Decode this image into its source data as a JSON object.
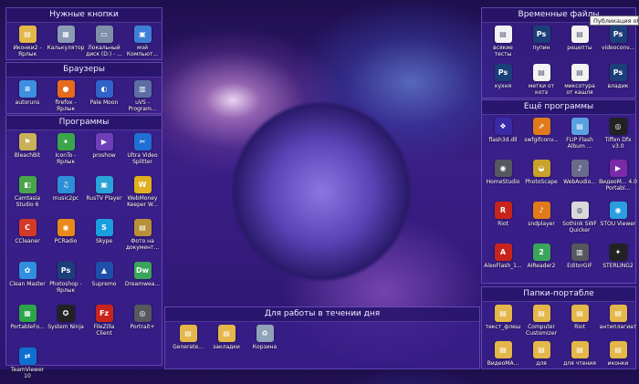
{
  "fences": {
    "nuzhnye": {
      "title": "Нужные кнопки",
      "items": [
        {
          "label": "Иконки2 - Ярлык",
          "icon": "folder-icon",
          "color": "#e3b74a",
          "glyph": "▤"
        },
        {
          "label": "Калькулятор",
          "icon": "calculator-icon",
          "color": "#8a9bb5",
          "glyph": "▦"
        },
        {
          "label": "Локальный диск (D:) - ...",
          "icon": "hard-drive-icon",
          "color": "#7e8fa8",
          "glyph": "▭"
        },
        {
          "label": "мой Компьют...",
          "icon": "computer-icon",
          "color": "#3d7fd6",
          "glyph": "▣"
        }
      ]
    },
    "brauzery": {
      "title": "Браузеры",
      "items": [
        {
          "label": "autoruns",
          "icon": "autoruns-icon",
          "color": "#3d8fe0",
          "glyph": "≡"
        },
        {
          "label": "firefox - Ярлык",
          "icon": "firefox-icon",
          "color": "#e86a1c",
          "glyph": "●"
        },
        {
          "label": "Pale Moon",
          "icon": "pale-moon-icon",
          "color": "#2f63c9",
          "glyph": "◐"
        },
        {
          "label": "uVS - Program...",
          "icon": "uvs-program-icon",
          "color": "#5c6ea3",
          "glyph": "▥"
        }
      ]
    },
    "programmy": {
      "title": "Программы",
      "items": [
        {
          "label": "BleachBit",
          "icon": "bleachbit-icon",
          "color": "#c9b15a",
          "glyph": "⚑"
        },
        {
          "label": "IconTo - Ярлык",
          "icon": "iconto-icon",
          "color": "#3aa54a",
          "glyph": "✦"
        },
        {
          "label": "proshow",
          "icon": "proshow-icon",
          "color": "#6e3fb8",
          "glyph": "▶"
        },
        {
          "label": "Ultra Video Splitter",
          "icon": "video-splitter-icon",
          "color": "#1f6fd6",
          "glyph": "✂"
        },
        {
          "label": "Camtasia Studio 6",
          "icon": "camtasia-icon",
          "color": "#4aa54a",
          "glyph": "◧"
        },
        {
          "label": "music2pc",
          "icon": "music2pc-icon",
          "color": "#2c8fd8",
          "glyph": "♫"
        },
        {
          "label": "RusTV Player",
          "icon": "rustv-icon",
          "color": "#29a3d9",
          "glyph": "▣"
        },
        {
          "label": "WebMoney Keeper W...",
          "icon": "webmoney-icon",
          "color": "#e0b020",
          "glyph": "W"
        },
        {
          "label": "CCleaner",
          "icon": "ccleaner-icon",
          "color": "#d33a2a",
          "glyph": "C"
        },
        {
          "label": "PCRadio",
          "icon": "pcradio-icon",
          "color": "#e88a1a",
          "glyph": "◉"
        },
        {
          "label": "Skype",
          "icon": "skype-icon",
          "color": "#1a9ee0",
          "glyph": "S"
        },
        {
          "label": "Фото на документ...",
          "icon": "photo-document-icon",
          "color": "#b8903a",
          "glyph": "▤"
        },
        {
          "label": "Clean Master",
          "icon": "clean-master-icon",
          "color": "#2f8fe0",
          "glyph": "✿"
        },
        {
          "label": "Photoshop - Ярлык",
          "icon": "photoshop-icon",
          "color": "#1c3f7a",
          "glyph": "Ps"
        },
        {
          "label": "Supremo",
          "icon": "supremo-icon",
          "color": "#1e4fa8",
          "glyph": "▲"
        },
        {
          "label": "Dreamwea...",
          "icon": "dreamweaver-icon",
          "color": "#3aa55a",
          "glyph": "Dw"
        },
        {
          "label": "PortableFo...",
          "icon": "portable-folder-icon",
          "color": "#2ba54a",
          "glyph": "▦"
        },
        {
          "label": "System Ninja",
          "icon": "system-ninja-icon",
          "color": "#222222",
          "glyph": "✪"
        },
        {
          "label": "FileZilla Client",
          "icon": "filezilla-icon",
          "color": "#c8241c",
          "glyph": "Fz"
        },
        {
          "label": "Portrait+",
          "icon": "portrait-plus-icon",
          "color": "#55585e",
          "glyph": "◎"
        },
        {
          "label": "TeamViewer 10",
          "icon": "teamviewer-icon",
          "color": "#0e6fd0",
          "glyph": "⇄"
        }
      ]
    },
    "vremennye": {
      "title": "Временные файлы",
      "items": [
        {
          "label": "всякие тесты",
          "icon": "document-icon",
          "color": "#f2f2f2",
          "glyph": "▤"
        },
        {
          "label": "пупин",
          "icon": "psd-file-icon",
          "color": "#1c3f7a",
          "glyph": "Ps"
        },
        {
          "label": "рецепты",
          "icon": "document-icon",
          "color": "#f2f2f2",
          "glyph": "▤"
        },
        {
          "label": "videoconv...",
          "icon": "psd-file-icon",
          "color": "#1c3f7a",
          "glyph": "Ps"
        },
        {
          "label": "кухня",
          "icon": "psd-file-icon",
          "color": "#1c3f7a",
          "glyph": "Ps"
        },
        {
          "label": "метки от котэ",
          "icon": "document-icon",
          "color": "#f2f2f2",
          "glyph": "▤"
        },
        {
          "label": "миксотура от кашля",
          "icon": "document-icon",
          "color": "#f2f2f2",
          "glyph": "▤"
        },
        {
          "label": "владик",
          "icon": "psd-file-icon",
          "color": "#1c3f7a",
          "glyph": "Ps"
        }
      ]
    },
    "esche": {
      "title": "Ещё программы",
      "items": [
        {
          "label": "flash3d.dll",
          "icon": "flash3d-icon",
          "color": "#3a2aa8",
          "glyph": "❖"
        },
        {
          "label": "swfgifconv...",
          "icon": "swfgif-icon",
          "color": "#e07a1a",
          "glyph": "⇗"
        },
        {
          "label": "FLIP Flash Album ...",
          "icon": "flip-album-icon",
          "color": "#5aa0e0",
          "glyph": "▤"
        },
        {
          "label": "Tiffen Dfx v3.0",
          "icon": "tiffen-icon",
          "color": "#222222",
          "glyph": "◎"
        },
        {
          "label": "HomeStudio",
          "icon": "homestudio-icon",
          "color": "#55585e",
          "glyph": "◉"
        },
        {
          "label": "PhotoScape",
          "icon": "photoscape-icon",
          "color": "#c8a22a",
          "glyph": "◒"
        },
        {
          "label": "WebAudio...",
          "icon": "webaudio-icon",
          "color": "#6a6a8a",
          "glyph": "♪"
        },
        {
          "label": "ВидеоМ... 4.0 Portabl...",
          "icon": "videomaster-icon",
          "color": "#7a2aa8",
          "glyph": "▶"
        },
        {
          "label": "Riot",
          "icon": "riot-icon",
          "color": "#c8241c",
          "glyph": "R"
        },
        {
          "label": "sndplayer",
          "icon": "sndplayer-icon",
          "color": "#e07a1a",
          "glyph": "♪"
        },
        {
          "label": "Sothink SWF Quicker",
          "icon": "sothink-icon",
          "color": "#d9d9d9",
          "glyph": "◍"
        },
        {
          "label": "STOU Viewer",
          "icon": "stou-icon",
          "color": "#2a9ee0",
          "glyph": "◉"
        },
        {
          "label": "AleoFlash_1...",
          "icon": "aleoflash-icon",
          "color": "#c8241c",
          "glyph": "A"
        },
        {
          "label": "AIReader2",
          "icon": "aireader-icon",
          "color": "#3aa55a",
          "glyph": "2"
        },
        {
          "label": "EditorGIF",
          "icon": "editorgif-icon",
          "color": "#55585e",
          "glyph": "▥"
        },
        {
          "label": "STERLING2",
          "icon": "sterling-icon",
          "color": "#222222",
          "glyph": "✦"
        }
      ]
    },
    "rabota": {
      "title": "Для работы в течении дня",
      "items": [
        {
          "label": "Generate...",
          "icon": "folder-icon",
          "color": "#e3b74a",
          "glyph": "▤"
        },
        {
          "label": "закладки",
          "icon": "folder-icon",
          "color": "#e3b74a",
          "glyph": "▤"
        },
        {
          "label": "Корзина",
          "icon": "recycle-bin-icon",
          "color": "#8fa3b8",
          "glyph": "♻"
        }
      ]
    },
    "papki": {
      "title": "Папки-портабле",
      "items": [
        {
          "label": "текст_флеш",
          "icon": "folder-icon",
          "color": "#e3b74a",
          "glyph": "▤"
        },
        {
          "label": "Computer Customizer",
          "icon": "folder-icon",
          "color": "#e3b74a",
          "glyph": "▤"
        },
        {
          "label": "Riot",
          "icon": "folder-icon",
          "color": "#e3b74a",
          "glyph": "▤"
        },
        {
          "label": "антиплагиат",
          "icon": "folder-icon",
          "color": "#e3b74a",
          "glyph": "▤"
        },
        {
          "label": "ВидеоМА...",
          "icon": "folder-icon",
          "color": "#e3b74a",
          "glyph": "▤"
        },
        {
          "label": "для",
          "icon": "folder-icon",
          "color": "#e3b74a",
          "glyph": "▤"
        },
        {
          "label": "для чтения",
          "icon": "folder-icon",
          "color": "#e3b74a",
          "glyph": "▤"
        },
        {
          "label": "иконки",
          "icon": "folder-icon",
          "color": "#e3b74a",
          "glyph": "▤"
        }
      ]
    }
  },
  "tooltip": "Публикация обл"
}
